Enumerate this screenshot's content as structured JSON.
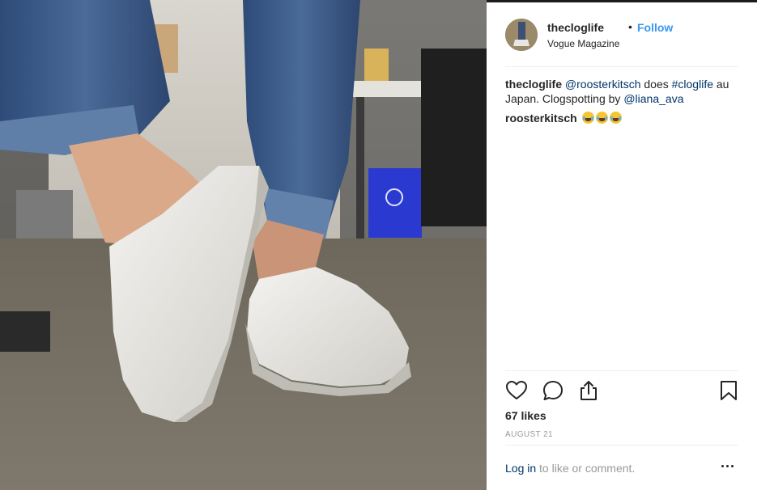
{
  "post": {
    "username": "thecloglife",
    "separator": "•",
    "follow_label": "Follow",
    "location": "Vogue Magazine"
  },
  "caption": {
    "username": "thecloglife",
    "mention1": "@roosterkitsch",
    "text1": " does ",
    "hashtag": "#cloglife",
    "text2": " au Japan. Clogspotting by ",
    "mention2": "@liana_ava"
  },
  "comment": {
    "username": "roosterkitsch",
    "emoji_count": 3,
    "emoji_name": "face-with-tears-of-joy"
  },
  "actions": {
    "like_icon": "heart-icon",
    "comment_icon": "comment-icon",
    "share_icon": "share-icon",
    "save_icon": "bookmark-icon"
  },
  "likes": "67 likes",
  "date": "AUGUST 21",
  "footer": {
    "login_label": "Log in",
    "login_suffix": " to like or comment.",
    "more_icon": "more-options-icon"
  },
  "colors": {
    "link_blue": "#003569",
    "follow_blue": "#3897f0",
    "muted": "#999999",
    "text": "#262626"
  }
}
